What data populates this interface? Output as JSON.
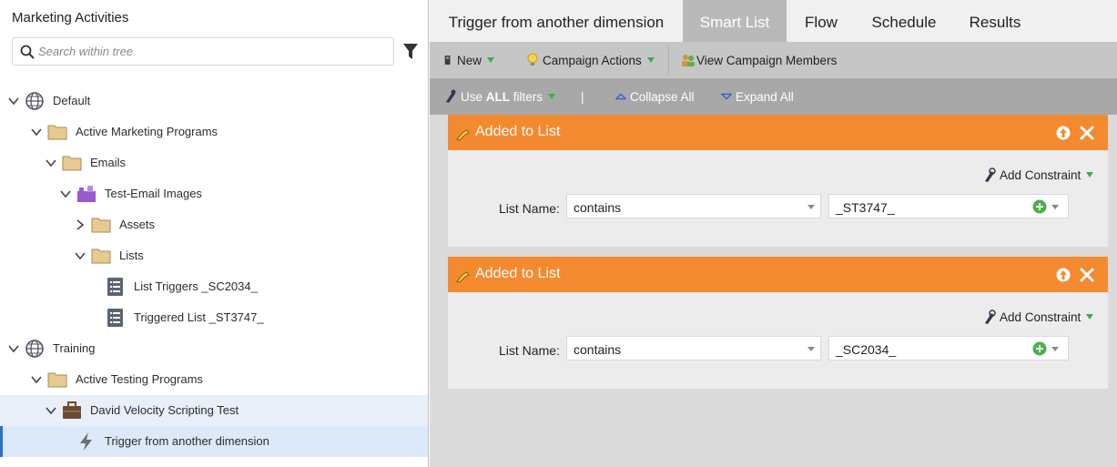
{
  "left": {
    "title": "Marketing Activities",
    "search": {
      "placeholder": "Search within tree",
      "value": ""
    },
    "tree": [
      {
        "label": "Default",
        "icon": "globe-icon",
        "expanded": true
      },
      {
        "label": "Active Marketing Programs",
        "icon": "folder-icon",
        "expanded": true
      },
      {
        "label": "Emails",
        "icon": "folder-icon",
        "expanded": true
      },
      {
        "label": "Test-Email Images",
        "icon": "program-icon",
        "expanded": true
      },
      {
        "label": "Assets",
        "icon": "folder-icon",
        "expanded": false
      },
      {
        "label": "Lists",
        "icon": "folder-icon",
        "expanded": true
      },
      {
        "label": "List Triggers _SC2034_",
        "icon": "list-icon"
      },
      {
        "label": "Triggered List _ST3747_",
        "icon": "list-icon"
      },
      {
        "label": "Training",
        "icon": "globe-icon",
        "expanded": true
      },
      {
        "label": "Active Testing Programs",
        "icon": "folder-icon",
        "expanded": true
      },
      {
        "label": "David Velocity Scripting Test",
        "icon": "briefcase-icon",
        "expanded": true
      },
      {
        "label": "Trigger from another dimension",
        "icon": "lightning-icon",
        "selected": true
      }
    ]
  },
  "tabs": [
    {
      "label": "Trigger from another dimension"
    },
    {
      "label": "Smart List",
      "active": true
    },
    {
      "label": "Flow"
    },
    {
      "label": "Schedule"
    },
    {
      "label": "Results"
    }
  ],
  "toolbar": {
    "new_label": "New",
    "campaign_actions_label": "Campaign Actions",
    "view_members_label": "View Campaign Members"
  },
  "filter_toolbar": {
    "use_filters_prefix": "Use ",
    "use_filters_bold": "ALL",
    "use_filters_suffix": " filters",
    "separator": "|",
    "collapse_label": "Collapse All",
    "expand_label": "Expand All"
  },
  "filters": [
    {
      "title": "Added to List",
      "add_constraint_label": "Add Constraint",
      "field_label": "List Name:",
      "operator": "contains",
      "value": "_ST3747_"
    },
    {
      "title": "Added to List",
      "add_constraint_label": "Add Constraint",
      "field_label": "List Name:",
      "operator": "contains",
      "value": "_SC2034_"
    }
  ],
  "colors": {
    "filter_header": "#f48a2f",
    "active_tab": "#b9b9b9",
    "selection_accent": "#2c6fd4",
    "dropdown_arrow": "#3fae3f"
  }
}
